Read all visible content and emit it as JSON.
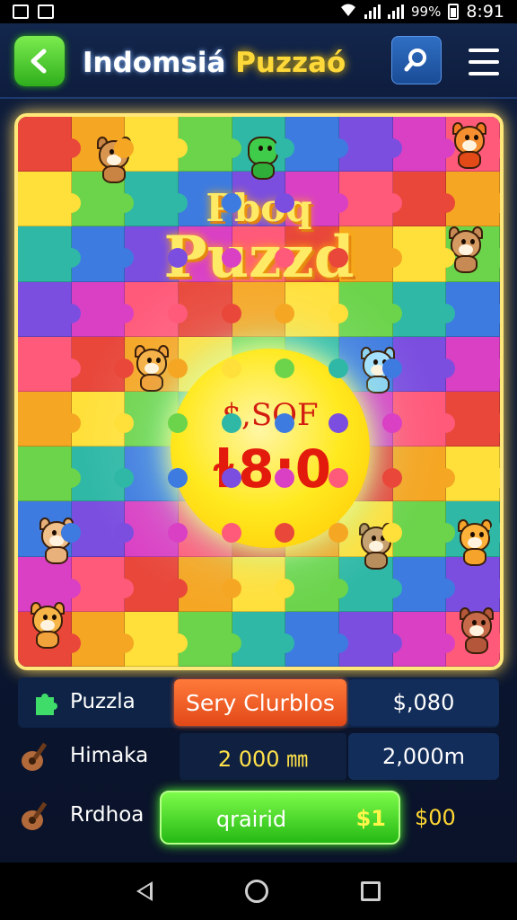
{
  "status_bar": {
    "signal_text": "99%",
    "time": "8:91"
  },
  "header": {
    "title_part1": "Indomsiá",
    "title_part2": "Puzzaó",
    "back_icon": "arrow-left-icon",
    "search_icon": "search-icon",
    "menu_icon": "hamburger-menu-icon"
  },
  "board": {
    "title_line1": "Pboq",
    "title_line2": "Puzzd",
    "coin_line1": "$,SOF",
    "coin_line2": "ɫ8:0",
    "tile_colors": [
      "#e8473a",
      "#f5a623",
      "#ffe03a",
      "#6bd44b",
      "#2fb8a6",
      "#3d7be0",
      "#7b4ee0",
      "#d940c4",
      "#ff5a7a"
    ]
  },
  "stats": {
    "row1": {
      "label": "Puzzla",
      "pill": "Sery Clurblos",
      "value": "$,080"
    },
    "row2": {
      "label": "Himaka",
      "value_a": "2 000 ㎜",
      "value_b": "2,000m"
    },
    "row3": {
      "label": "Rrdhoa",
      "button_label": "qrairid",
      "button_amount": "$1",
      "gold_value": "$00"
    }
  },
  "colors": {
    "accent_green": "#2fae1c",
    "gold": "#ffd633",
    "orange": "#e24818",
    "board_border": "#ffe879"
  }
}
